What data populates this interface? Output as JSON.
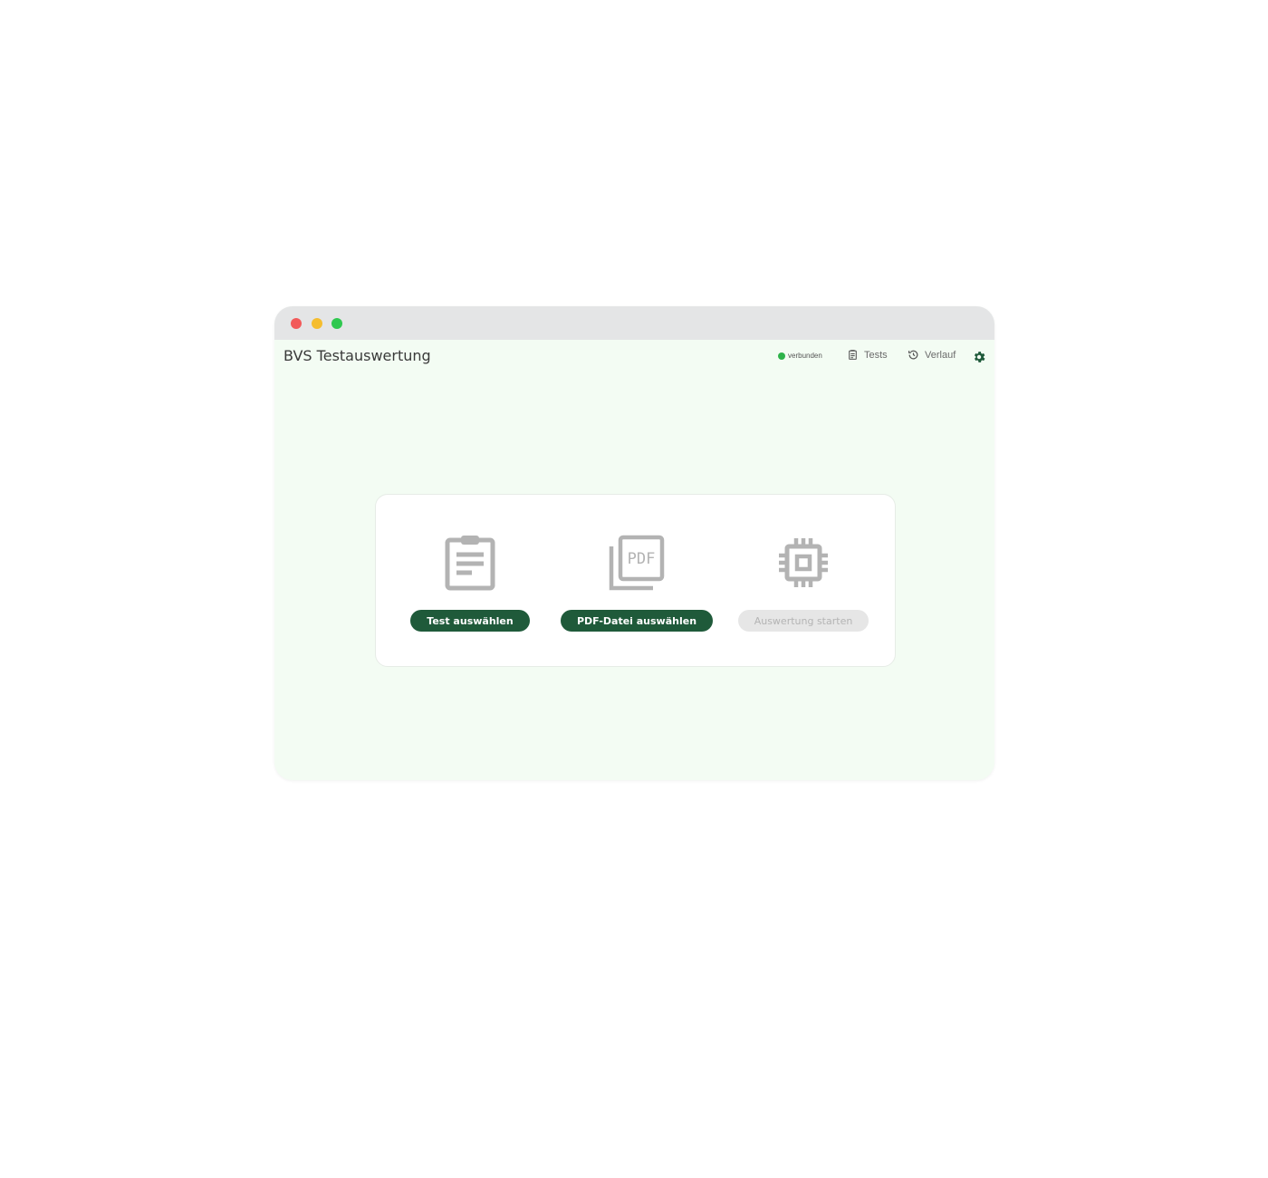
{
  "colors": {
    "primary": "#1f5a3a",
    "status_ok": "#2eb34a",
    "icon_gray": "#b3b3b3",
    "disabled_bg": "#e6e6e6",
    "traffic_red": "#f25a5a",
    "traffic_yellow": "#f5bd2f",
    "traffic_green": "#2fc84f"
  },
  "app": {
    "title": "BVS Testauswertung"
  },
  "header": {
    "status_label": "verbunden",
    "nav": [
      {
        "label": "Tests",
        "icon": "clipboard-icon"
      },
      {
        "label": "Verlauf",
        "icon": "history-icon"
      }
    ],
    "settings_icon": "gear-icon"
  },
  "actions": [
    {
      "icon": "clipboard-list-icon",
      "label": "Test auswählen",
      "enabled": true
    },
    {
      "icon": "pdf-files-icon",
      "label": "PDF-Datei auswählen",
      "enabled": true,
      "icon_text": "PDF"
    },
    {
      "icon": "cpu-chip-icon",
      "label": "Auswertung starten",
      "enabled": false
    }
  ]
}
